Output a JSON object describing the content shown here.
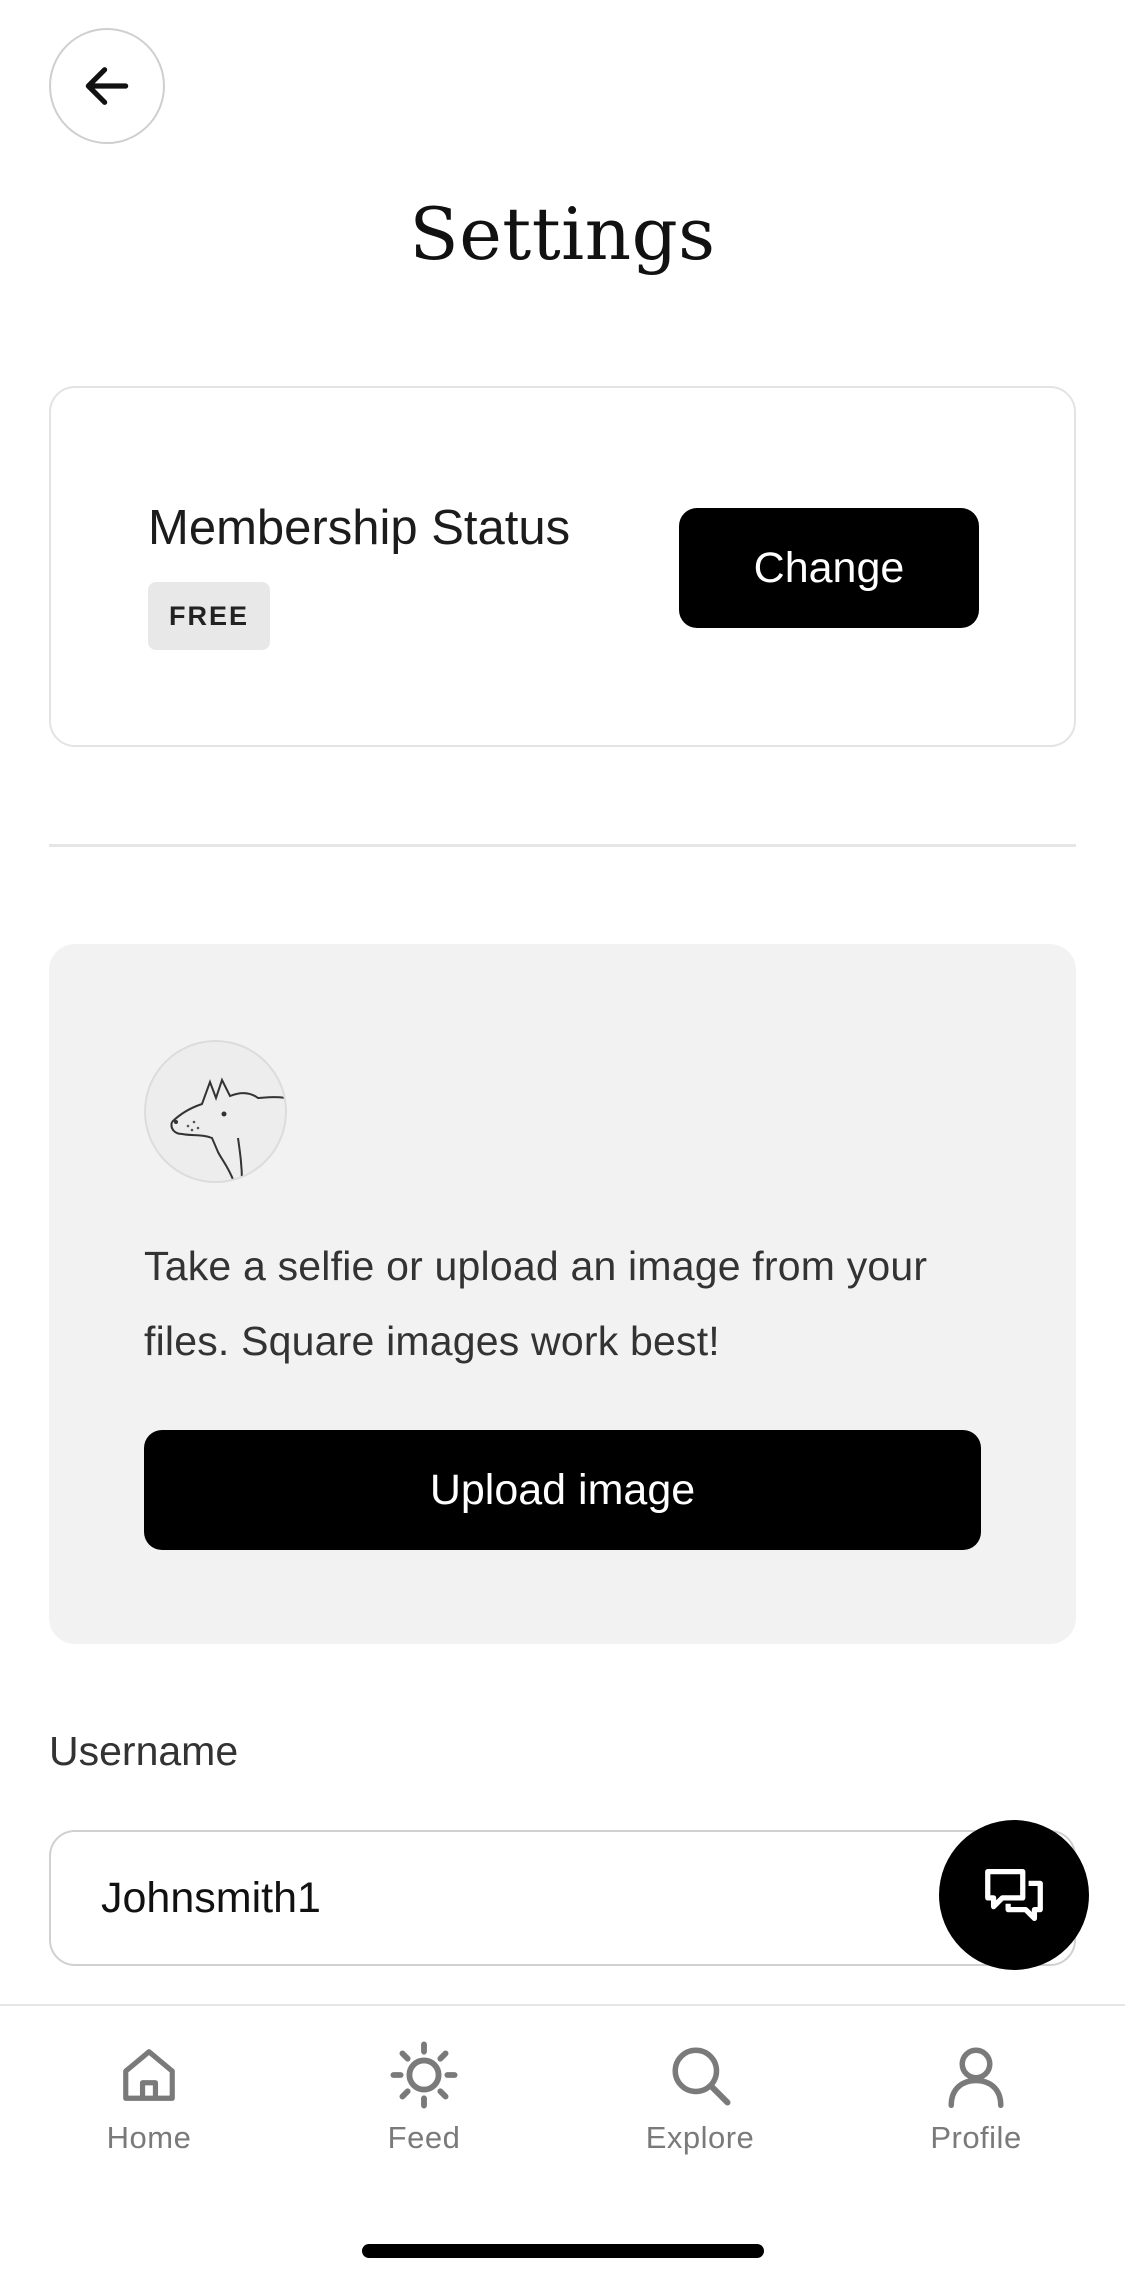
{
  "header": {
    "back_icon": "arrow-left-icon",
    "title": "Settings"
  },
  "membership": {
    "label": "Membership Status",
    "badge": "FREE",
    "change_label": "Change"
  },
  "profile_image": {
    "avatar_icon": "hyena-sketch-avatar",
    "description": "Take a selfie or upload an image from your files. Square images work best!",
    "upload_label": "Upload image"
  },
  "username": {
    "label": "Username",
    "value": "Johnsmith1"
  },
  "chat_fab": {
    "icon": "chat-bubbles-icon"
  },
  "tabs": [
    {
      "label": "Home",
      "icon": "home-icon"
    },
    {
      "label": "Feed",
      "icon": "sun-icon"
    },
    {
      "label": "Explore",
      "icon": "search-icon"
    },
    {
      "label": "Profile",
      "icon": "user-icon"
    }
  ],
  "colors": {
    "primary": "#000000",
    "card_background": "#f2f2f2",
    "badge_background": "#e8e8e8",
    "tab_inactive": "#7a7a7a"
  }
}
